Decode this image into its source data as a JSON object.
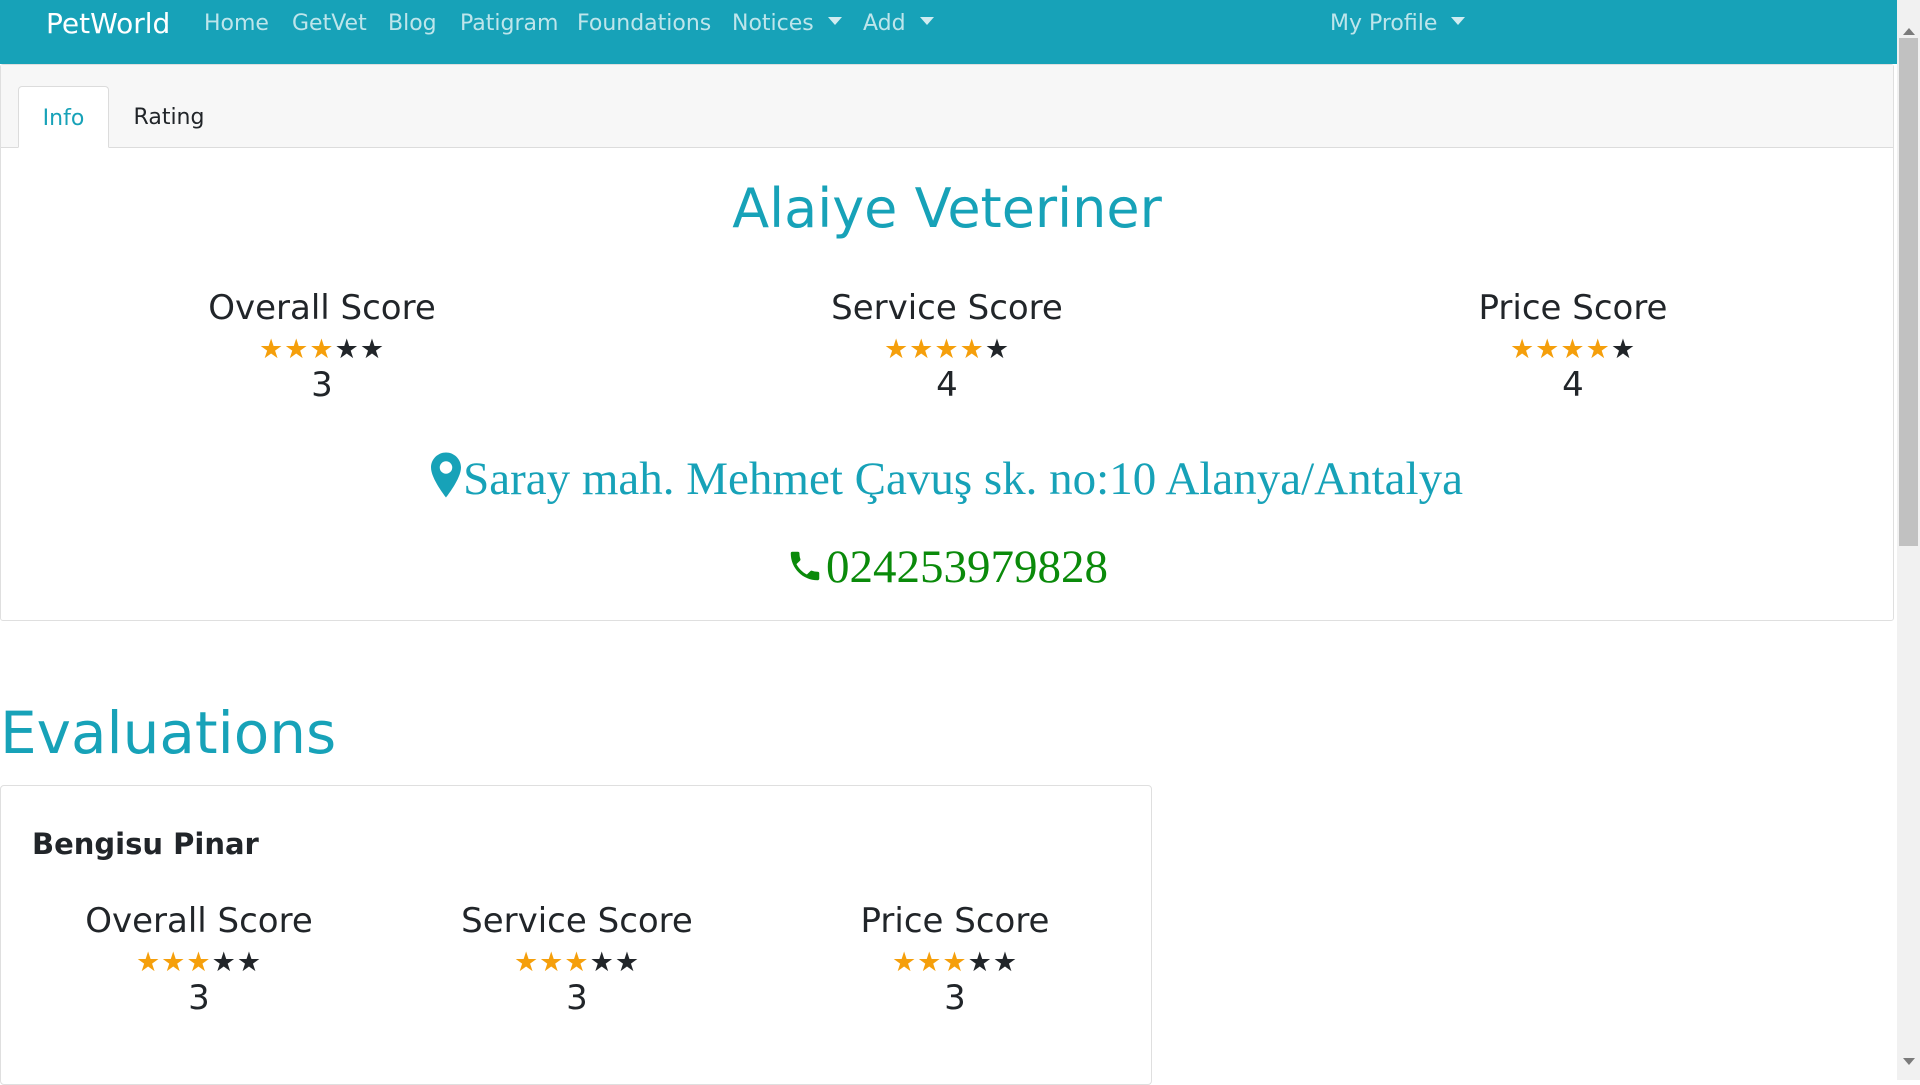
{
  "navbar": {
    "brand": "PetWorld",
    "items": [
      {
        "label": "Home",
        "dropdown": false
      },
      {
        "label": "GetVet",
        "dropdown": false
      },
      {
        "label": "Blog",
        "dropdown": false
      },
      {
        "label": "Patigram",
        "dropdown": false
      },
      {
        "label": "Foundations",
        "dropdown": false
      },
      {
        "label": "Notices",
        "dropdown": true
      },
      {
        "label": "Add",
        "dropdown": true
      }
    ],
    "profile": "My Profile"
  },
  "tabs": [
    {
      "label": "Info",
      "active": true
    },
    {
      "label": "Rating",
      "active": false
    }
  ],
  "vet": {
    "name": "Alaiye Veteriner",
    "scores": [
      {
        "title": "Overall Score",
        "value": "3",
        "stars": 3
      },
      {
        "title": "Service Score",
        "value": "4",
        "stars": 4
      },
      {
        "title": "Price Score",
        "value": "4",
        "stars": 4
      }
    ],
    "address": "Saray mah. Mehmet Çavuş sk. no:10 Alanya/Antalya",
    "phone": "024253979828"
  },
  "evaluations": {
    "heading": "Evaluations",
    "items": [
      {
        "reviewer": "Bengisu Pinar",
        "scores": [
          {
            "title": "Overall Score",
            "value": "3",
            "stars": 3
          },
          {
            "title": "Service Score",
            "value": "3",
            "stars": 3
          },
          {
            "title": "Price Score",
            "value": "3",
            "stars": 3
          }
        ]
      }
    ]
  },
  "colors": {
    "primary": "#17a2b8",
    "star_filled": "#f59f0b",
    "star_empty": "#212529",
    "phone": "#0a8a0a"
  },
  "icons": {
    "address": "map-marker-icon",
    "phone": "phone-icon"
  }
}
